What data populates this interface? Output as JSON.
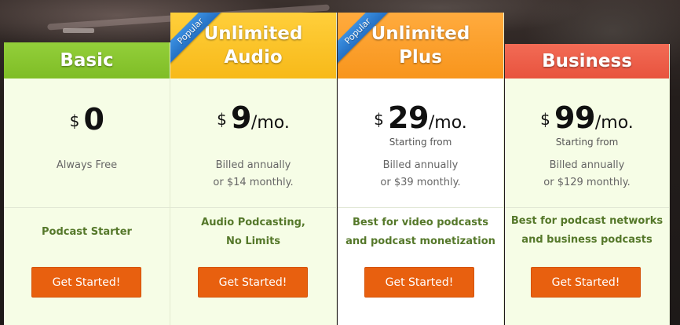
{
  "plans": [
    {
      "name": "Basic",
      "badge": "",
      "currency": "$",
      "amount": "0",
      "period": "",
      "starting": "",
      "billing_line1": "Always Free",
      "billing_line2": "",
      "feature_line1": "Podcast Starter",
      "feature_line2": "",
      "cta": "Get Started!",
      "header_color": "#86c52e"
    },
    {
      "name_line1": "Unlimited",
      "name_line2": "Audio",
      "badge": "Popular",
      "currency": "$",
      "amount": "9",
      "period": "/mo.",
      "starting": "",
      "billing_line1": "Billed annually",
      "billing_line2": "or $14 monthly.",
      "feature_line1": "Audio Podcasting,",
      "feature_line2": "No Limits",
      "cta": "Get Started!",
      "header_color": "#fbc42a"
    },
    {
      "name_line1": "Unlimited",
      "name_line2": "Plus",
      "badge": "Popular",
      "currency": "$",
      "amount": "29",
      "period": "/mo.",
      "starting": "Starting from",
      "billing_line1": "Billed annually",
      "billing_line2": "or $39 monthly.",
      "feature_line1": "Best for video podcasts",
      "feature_line2": "and podcast monetization",
      "cta": "Get Started!",
      "header_color": "#fb9f2c"
    },
    {
      "name": "Business",
      "badge": "",
      "currency": "$",
      "amount": "99",
      "period": "/mo.",
      "starting": "Starting from",
      "billing_line1": "Billed annually",
      "billing_line2": "or $129 monthly.",
      "feature_line1": "Best for podcast networks",
      "feature_line2": "and business podcasts",
      "cta": "Get Started!",
      "header_color": "#ee5f49"
    }
  ],
  "colors": {
    "cta": "#e8600f",
    "feature_text": "#55782a",
    "badge": "#2f80d4"
  }
}
